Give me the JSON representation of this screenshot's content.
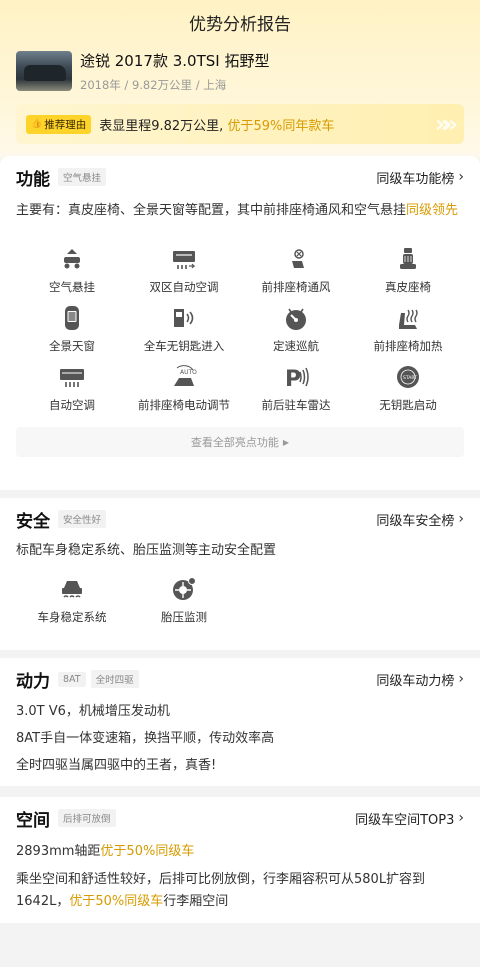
{
  "header": {
    "title": "优势分析报告"
  },
  "car": {
    "title": "途锐 2017款 3.0TSI 拓野型",
    "subtitle": "2018年 / 9.82万公里 / 上海"
  },
  "reason": {
    "tag": "推荐理由",
    "text": "表显里程9.82万公里,",
    "highlight": "优于59%同年款车"
  },
  "features": {
    "title": "功能",
    "chip": "空气悬挂",
    "link": "同级车功能榜",
    "desc": "主要有：真皮座椅、全景天窗等配置，其中前排座椅通风和空气悬挂",
    "desc_hl": "同级领先",
    "items": [
      {
        "label": "空气悬挂",
        "icon": "air-suspension-icon"
      },
      {
        "label": "双区自动空调",
        "icon": "dual-zone-ac-icon"
      },
      {
        "label": "前排座椅通风",
        "icon": "seat-ventilation-icon"
      },
      {
        "label": "真皮座椅",
        "icon": "leather-seat-icon"
      },
      {
        "label": "全景天窗",
        "icon": "panoramic-sunroof-icon"
      },
      {
        "label": "全车无钥匙进入",
        "icon": "keyless-entry-icon"
      },
      {
        "label": "定速巡航",
        "icon": "cruise-control-icon"
      },
      {
        "label": "前排座椅加热",
        "icon": "seat-heating-icon"
      },
      {
        "label": "自动空调",
        "icon": "auto-ac-icon"
      },
      {
        "label": "前排座椅电动调节",
        "icon": "power-seat-icon"
      },
      {
        "label": "前后驻车雷达",
        "icon": "parking-radar-icon"
      },
      {
        "label": "无钥匙启动",
        "icon": "keyless-start-icon"
      }
    ],
    "view_all": "查看全部亮点功能"
  },
  "safety": {
    "title": "安全",
    "chip": "安全性好",
    "link": "同级车安全榜",
    "desc": "标配车身稳定系统、胎压监测等主动安全配置",
    "items": [
      {
        "label": "车身稳定系统",
        "icon": "stability-control-icon"
      },
      {
        "label": "胎压监测",
        "icon": "tire-pressure-icon"
      }
    ]
  },
  "power": {
    "title": "动力",
    "chips": [
      "8AT",
      "全时四驱"
    ],
    "link": "同级车动力榜",
    "lines": [
      "3.0T V6，机械增压发动机",
      "8AT手自一体变速箱，换挡平顺，传动效率高",
      "全时四驱当属四驱中的王者，真香!"
    ]
  },
  "space": {
    "title": "空间",
    "chip": "后排可放倒",
    "link": "同级车空间TOP3",
    "line1": "2893mm轴距",
    "line1_hl": "优于50%同级车",
    "line2": "乘坐空间和舒适性较好，后排可比例放倒，行李厢容积可从580L扩容到1642L，",
    "line2_hl": "优于50%同级车",
    "line2_end": "行李厢空间"
  },
  "colors": {
    "accent": "#d79b00",
    "tag_bg": "#ffd42a",
    "bg": "#f3f3f3"
  }
}
